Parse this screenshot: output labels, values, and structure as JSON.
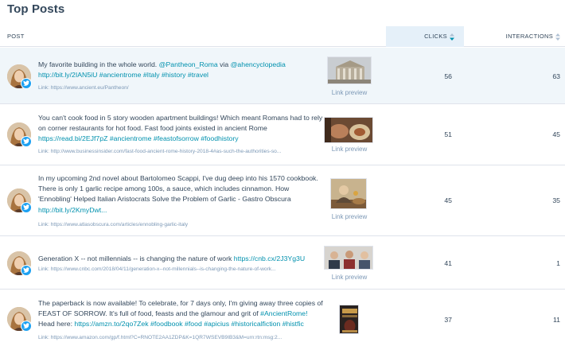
{
  "title": "Top Posts",
  "columns": {
    "post": "POST",
    "clicks": "CLICKS",
    "interactions": "INTERACTIONS"
  },
  "preview_label": "Link preview",
  "colors": {
    "link": "#0091ae",
    "twitter": "#1da1f2",
    "highlight": "#f0f6fa",
    "sort_active": "#0091ae"
  },
  "posts": [
    {
      "text_plain": "My favorite building in the whole world. ",
      "text_parts": [
        "My favorite building in the whole world. ",
        "@Pantheon_Roma",
        " via ",
        "@ahencyclopedia",
        " ",
        "http://bit.ly/2IAN5iU",
        " ",
        "#ancientrome",
        " ",
        "#Italy",
        " ",
        "#history",
        " ",
        "#travel"
      ],
      "link": "Link: https://www.ancient.eu/Pantheon/",
      "clicks": "56",
      "interactions": "63"
    },
    {
      "text_parts": [
        "You can't cook food in 5 story wooden apartment buildings! Which meant Romans had to rely on corner restaurants for hot food. Fast food joints existed in ancient Rome ",
        "https://read.bi/2EJf7pZ",
        " ",
        "#ancientrome",
        " ",
        "#feastofsorrow",
        " ",
        "#foodhistory"
      ],
      "link": "Link: http://www.businessinsider.com/fast-food-ancient-rome-history-2018-4#as-such-the-authorities-so...",
      "clicks": "51",
      "interactions": "45"
    },
    {
      "text_parts": [
        "In my upcoming 2nd novel about Bartolomeo Scappi, I've dug deep into his 1570 cookbook. There is only 1 garlic recipe among 100s, a sauce, which includes cinnamon. How 'Ennobling' Helped Italian Aristocrats Solve the Problem of Garlic - Gastro Obscura ",
        "http://bit.ly/2KmyDwt...",
        ""
      ],
      "link": "Link: https://www.atlasobscura.com/articles/ennobling-garlic-italy",
      "clicks": "45",
      "interactions": "35"
    },
    {
      "text_parts": [
        "Generation X -- not millennials -- is changing the nature of work ",
        "https://cnb.cx/2J3Yg3U",
        ""
      ],
      "link": "Link: https://www.cnbc.com/2018/04/11/generation-x--not-millennials--is-changing-the-nature-of-work...",
      "clicks": "41",
      "interactions": "1"
    },
    {
      "text_parts": [
        "The paperback is now available! To celebrate, for 7 days only, I'm giving away three copies of FEAST OF SORROW. It's full of food, feasts and the glamour and grit of ",
        "#AncientRome!",
        " Head here: ",
        "https://amzn.to/2qo7Zek",
        " ",
        "#foodbook",
        " ",
        "#food",
        " ",
        "#apicius",
        " ",
        "#historicalfiction",
        " ",
        "#histfic"
      ],
      "link": "Link: https://www.amazon.com/gp/f.html?C=RNOTE2AA1ZDP&K=1QR7WSEVB9IB3&M=urn:rtn:msg:2...",
      "clicks": "37",
      "interactions": "11"
    }
  ]
}
